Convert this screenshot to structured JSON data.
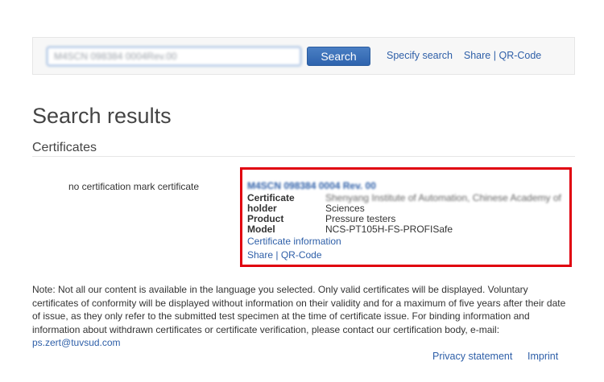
{
  "search": {
    "input_value": "M4SCN 098384 0004Rev.00",
    "button_label": "Search",
    "specify_label": "Specify search",
    "share_label": "Share",
    "separator": "|",
    "qr_label": "QR-Code"
  },
  "page": {
    "title": "Search results",
    "section": "Certificates"
  },
  "result": {
    "mark": "no certification mark certificate",
    "cert_id": "M4SCN 098384 0004 Rev. 00",
    "holder_label_1": "Certificate",
    "holder_label_2": "holder",
    "holder_value_1": "Shenyang Institute of Automation, Chinese Academy of",
    "holder_value_2": "Sciences",
    "product_label": "Product",
    "product_value": "Pressure testers",
    "model_label": "Model",
    "model_value": "NCS-PT105H-FS-PROFISafe",
    "info_link": "Certificate information",
    "share_label": "Share",
    "separator": "|",
    "qr_label": "QR-Code"
  },
  "note": {
    "text": "Note: Not all our content is available in the language you selected. Only valid certificates will be displayed. Voluntary certificates of conformity will be displayed without information on their validity and for a maximum of five years after their date of issue, as they only refer to the submitted test specimen at the time of certificate issue. For binding information and information about withdrawn certificates or certificate verification, please contact our certification body, e-mail: ",
    "email": "ps.zert@tuvsud.com"
  },
  "footer": {
    "privacy": "Privacy statement",
    "imprint": "Imprint"
  },
  "colors": {
    "link": "#2e5fa8",
    "highlight_border": "#e0000f",
    "button": "#3a6fb8"
  }
}
